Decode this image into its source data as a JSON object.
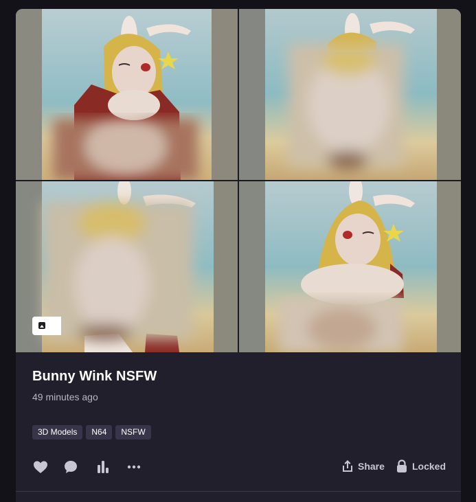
{
  "post": {
    "title": "Bunny Wink NSFW",
    "time_ago": "49 minutes ago",
    "tags": [
      "3D Models",
      "N64",
      "NSFW"
    ],
    "images": [
      {
        "name": "image-1",
        "content": "rabbit character winking, partially blurred"
      },
      {
        "name": "image-2",
        "content": "rabbit character, mostly blurred"
      },
      {
        "name": "image-3",
        "content": "rabbit character, mostly blurred"
      },
      {
        "name": "image-4",
        "content": "rabbit character winking, partially blurred"
      }
    ],
    "media_badge_icon": "image-icon"
  },
  "actions": {
    "like_icon": "heart-icon",
    "comment_icon": "comment-icon",
    "stats_icon": "bar-chart-icon",
    "more_icon": "more-dots-icon",
    "share_label": "Share",
    "share_icon": "share-icon",
    "locked_label": "Locked",
    "locked_icon": "lock-icon"
  },
  "colors": {
    "page_bg": "#141219",
    "card_bg": "#221f2c",
    "tag_bg": "#38354a",
    "text_primary": "#ffffff",
    "text_secondary": "#b9b6c4",
    "icon": "#c9c6d4"
  }
}
